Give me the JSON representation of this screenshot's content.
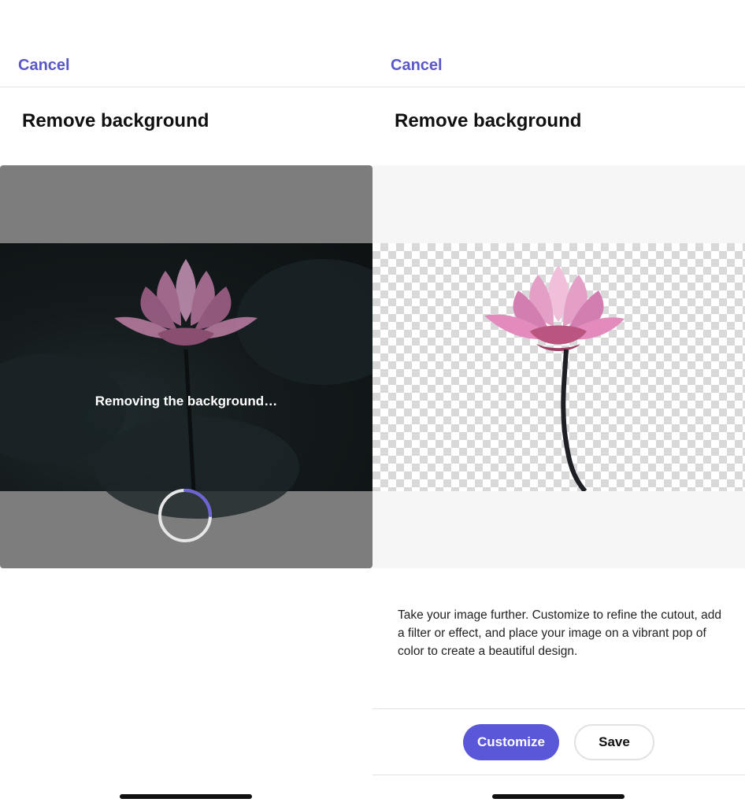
{
  "left": {
    "cancel_label": "Cancel",
    "title": "Remove background",
    "loading_text": "Removing the background…"
  },
  "right": {
    "cancel_label": "Cancel",
    "title": "Remove background",
    "description": "Take your image further. Customize to refine the cutout, add a filter or effect, and place your image on a vibrant pop of color to create a beautiful design.",
    "customize_label": "Customize",
    "save_label": "Save"
  },
  "colors": {
    "accent": "#5a57d9",
    "link": "#5a57c9",
    "overlay_gray": "#7d7d7d",
    "checker_light": "#ffffff",
    "checker_dark": "#d9d9d9"
  },
  "icons": [
    "loading-spinner-icon",
    "lotus-flower-image",
    "home-indicator"
  ]
}
